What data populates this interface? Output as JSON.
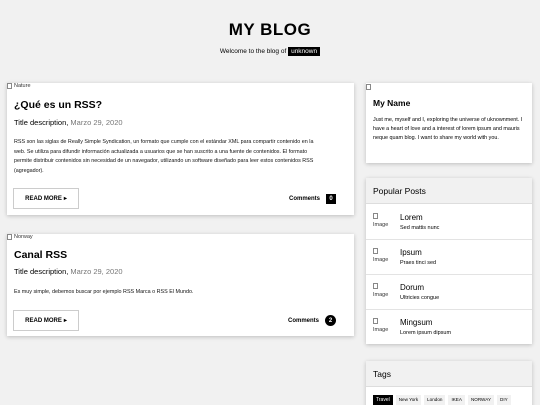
{
  "header": {
    "title": "MY BLOG",
    "welcome_prefix": "Welcome to the blog of",
    "user": "unknown"
  },
  "posts": [
    {
      "image_alt": "Nature",
      "title": "¿Qué es un RSS?",
      "description": "Title description,",
      "date": "Marzo 29, 2020",
      "text": "RSS son las siglas de Really Simple Syndication, un formato que cumple con el estándar XML para compartir contenido en la web. Se utiliza para difundir información actualizada a usuarios que se han suscrito a una fuente de contenidos. El formato permite distribuir contenidos sin necesidad de un navegador, utilizando un software diseñado para leer estos contenidos RSS (agregador).",
      "read_more": "READ MORE",
      "read_more_arrow": "▸",
      "comments_label": "Comments",
      "comments_count": "0"
    },
    {
      "image_alt": "Norway",
      "title": "Canal RSS",
      "description": "Title description,",
      "date": "Marzo 29, 2020",
      "text": "Es muy simple, debemos buscar por ejemplo RSS Marca o RSS El Mundo.",
      "read_more": "READ MORE",
      "read_more_arrow": "▸",
      "comments_label": "Comments",
      "comments_count": "2"
    }
  ],
  "about": {
    "name": "My Name",
    "bio": "Just me, myself and I, exploring the universe of uknownment. I have a heart of love and a interest of lorem ipsum and mauris neque quam blog. I want to share my world with you."
  },
  "popular": {
    "title": "Popular Posts",
    "image_alt": "Image",
    "items": [
      {
        "name": "Lorem",
        "sub": "Sed mattis nunc"
      },
      {
        "name": "Ipsum",
        "sub": "Praes tinci sed"
      },
      {
        "name": "Dorum",
        "sub": "Ultricies congue"
      },
      {
        "name": "Mingsum",
        "sub": "Lorem ipsum dipsum"
      }
    ]
  },
  "tags": {
    "title": "Tags",
    "items": [
      "Travel",
      "New York",
      "London",
      "IKEA",
      "NORWAY",
      "DIY"
    ],
    "active": "Travel"
  },
  "icons": {
    "broken_image": "broken-image-icon",
    "arrow": "arrow-right-icon"
  }
}
